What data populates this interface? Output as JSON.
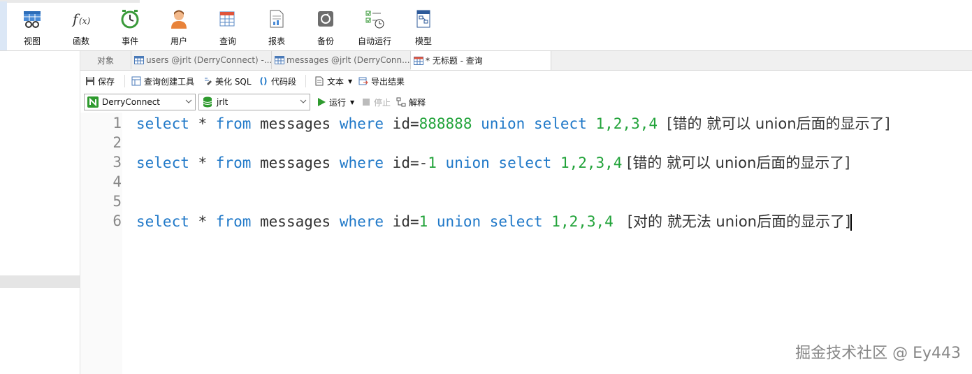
{
  "ribbon": {
    "items": [
      {
        "label": "视图",
        "icon": "table-view-icon"
      },
      {
        "label": "函数",
        "icon": "function-icon"
      },
      {
        "label": "事件",
        "icon": "clock-icon"
      },
      {
        "label": "用户",
        "icon": "user-icon"
      },
      {
        "label": "查询",
        "icon": "query-icon"
      },
      {
        "label": "报表",
        "icon": "report-icon"
      },
      {
        "label": "备份",
        "icon": "backup-icon"
      },
      {
        "label": "自动运行",
        "icon": "schedule-icon"
      },
      {
        "label": "模型",
        "icon": "model-icon"
      }
    ]
  },
  "tabs": [
    {
      "label": "对象"
    },
    {
      "label": "users @jrlt (DerryConnect) -..."
    },
    {
      "label": "messages @jrlt (DerryConn..."
    },
    {
      "label": "* 无标题 - 查询"
    }
  ],
  "toolbar": {
    "save": "保存",
    "query_builder": "查询创建工具",
    "beautify": "美化 SQL",
    "snippet": "代码段",
    "text": "文本",
    "export": "导出结果",
    "run": "运行",
    "stop": "停止",
    "explain": "解释"
  },
  "connection": {
    "conn_name": "DerryConnect",
    "db_name": "jrlt"
  },
  "editor": {
    "line_numbers": [
      "1",
      "2",
      "3",
      "4",
      "5",
      "6"
    ],
    "line1": {
      "kw1": "select",
      "star": " * ",
      "kw2": "from",
      "tbl": " messages ",
      "kw3": "where",
      "cond": " id=",
      "val": "888888",
      "kw4": " union ",
      "kw5": "select",
      "sp": " ",
      "nums": "1,2,3,4",
      "comment": "  [错的 就可以 union后面的显示了]"
    },
    "line3": {
      "kw1": "select",
      "star": " * ",
      "kw2": "from",
      "tbl": " messages ",
      "kw3": "where",
      "cond": " id=-",
      "val": "1",
      "kw4": " union ",
      "kw5": "select",
      "sp": " ",
      "nums": "1,2,3,4",
      "comment": " [错的 就可以 union后面的显示了]"
    },
    "line6": {
      "kw1": "select",
      "star": " * ",
      "kw2": "from",
      "tbl": " messages ",
      "kw3": "where",
      "cond": " id=",
      "val": "1",
      "kw4": " union ",
      "kw5": "select",
      "sp": " ",
      "nums": "1,2,3,4",
      "comment": "   [对的 就无法 union后面的显示了]"
    }
  },
  "watermark": "掘金技术社区 @ Ey443"
}
